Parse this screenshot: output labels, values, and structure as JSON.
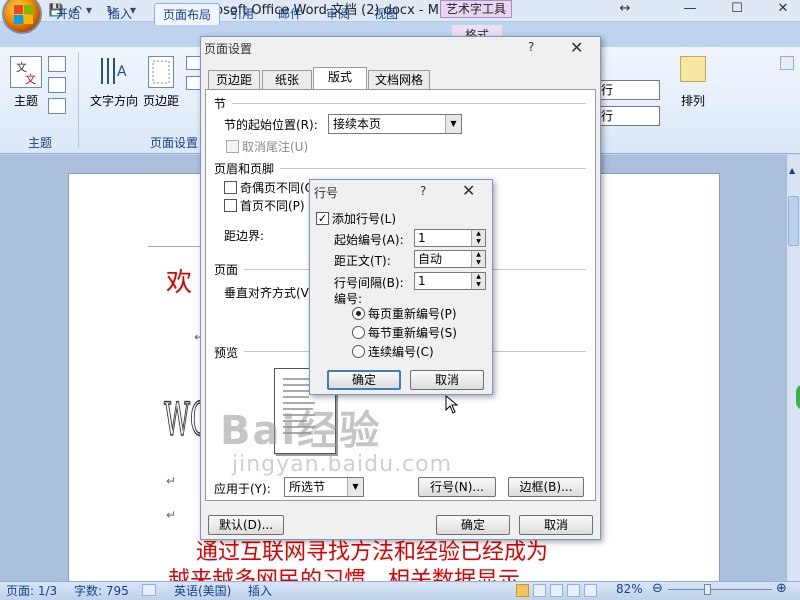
{
  "window": {
    "title": "新建 Microsoft Office Word 文档 (2).docx - M...",
    "tool_tab": "艺术字工具",
    "tool_subtab": "格式",
    "min": "—",
    "max": "☐",
    "close": "✕",
    "resize": "↔"
  },
  "qat": {
    "save": "💾",
    "undo": "↶",
    "undo_drop": "▾",
    "redo": "↻",
    "more": "▾"
  },
  "ribbon_tabs": [
    "开始",
    "插入",
    "页面布局",
    "引用",
    "邮件",
    "审阅",
    "视图"
  ],
  "ribbon": {
    "groups": {
      "theme": "主题",
      "page_setup": "页面设置"
    },
    "buttons": {
      "theme": "主题",
      "text_direction": "文字方向",
      "margins": "页边距",
      "arrange": "排列"
    },
    "right_fields": [
      "行",
      "行"
    ]
  },
  "page_setup_dialog": {
    "title": "页面设置",
    "help": "?",
    "close": "✕",
    "tabs": [
      "页边距",
      "纸张",
      "版式",
      "文档网格"
    ],
    "active_tab": "版式",
    "section_heading": "节",
    "section_start_label": "节的起始位置(R):",
    "section_start_value": "接续本页",
    "suppress_endnotes": "取消尾注(U)",
    "header_footer_heading": "页眉和页脚",
    "odd_even_diff": "奇偶页不同(O)",
    "first_page_diff": "首页不同(P)",
    "from_edge_label": "距边界:",
    "page_heading": "页面",
    "vertical_align_label": "垂直对齐方式(V):",
    "preview_heading": "预览",
    "apply_to_label": "应用于(Y):",
    "apply_to_value": "所选节",
    "line_numbers_button": "行号(N)...",
    "borders_button": "边框(B)...",
    "default_button": "默认(D)...",
    "ok_button": "确定",
    "cancel_button": "取消"
  },
  "line_numbers_dialog": {
    "title": "行号",
    "help": "?",
    "close": "✕",
    "add_line_numbers": "添加行号(L)",
    "add_line_numbers_checked": "✓",
    "start_at_label": "起始编号(A):",
    "start_at_value": "1",
    "from_text_label": "距正文(T):",
    "from_text_value": "自动",
    "count_by_label": "行号间隔(B):",
    "count_by_value": "1",
    "numbering_label": "编号:",
    "restart_each_page": "每页重新编号(P)",
    "restart_each_section": "每节重新编号(S)",
    "continuous": "连续编号(C)",
    "selected": "restart_each_page",
    "ok_button": "确定",
    "cancel_button": "取消"
  },
  "document": {
    "red_fragment": "欢",
    "wordart_fragment": "WO",
    "para_mark": "↵",
    "red_line1": "通过互联网寻找方法和经验已经成为",
    "red_line2": "越来越多网民的习惯，相关数据显示"
  },
  "watermark": {
    "brand": "Bai经验",
    "url": "jingyan.baidu.com"
  },
  "status": {
    "page": "页面: 1/3",
    "words": "字数: 795",
    "language": "英语(美国)",
    "insert": "插入",
    "zoom": "82%",
    "zoom_minus": "⊖",
    "zoom_plus": "⊕"
  },
  "colors": {
    "accent": "#15428b",
    "doc_red": "#e00000",
    "ribbon": "#dbe8f7"
  }
}
